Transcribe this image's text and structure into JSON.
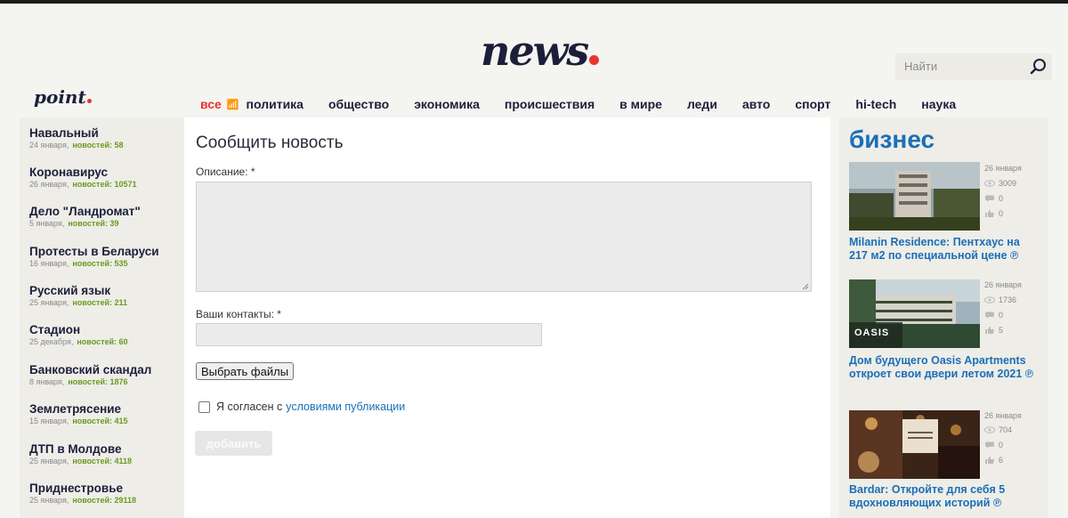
{
  "header": {
    "logo_main": "news",
    "logo_secondary": "point",
    "search_placeholder": "Найти",
    "accent_color": "#e8362b",
    "brand_color": "#1c1f3a"
  },
  "nav": {
    "active": "все",
    "items": [
      "политика",
      "общество",
      "экономика",
      "происшествия",
      "в мире",
      "леди",
      "авто",
      "спорт",
      "hi-tech",
      "наука"
    ]
  },
  "topics": [
    {
      "title": "Навальный",
      "date": "24 января,",
      "count_label": "новостей:",
      "count": "58"
    },
    {
      "title": "Коронавирус",
      "date": "26 января,",
      "count_label": "новостей:",
      "count": "10571"
    },
    {
      "title": "Дело \"Ландромат\"",
      "date": "5 января,",
      "count_label": "новостей:",
      "count": "39"
    },
    {
      "title": "Протесты в Беларуси",
      "date": "16 января,",
      "count_label": "новостей:",
      "count": "535"
    },
    {
      "title": "Русский язык",
      "date": "25 января,",
      "count_label": "новостей:",
      "count": "211"
    },
    {
      "title": "Стадион",
      "date": "25 декабря,",
      "count_label": "новостей:",
      "count": "60"
    },
    {
      "title": "Банковский скандал",
      "date": "8 января,",
      "count_label": "новостей:",
      "count": "1876"
    },
    {
      "title": "Землетрясение",
      "date": "15 января,",
      "count_label": "новостей:",
      "count": "415"
    },
    {
      "title": "ДТП в Молдове",
      "date": "25 января,",
      "count_label": "новостей:",
      "count": "4118"
    },
    {
      "title": "Приднестровье",
      "date": "25 января,",
      "count_label": "новостей:",
      "count": "29118"
    }
  ],
  "modal": {
    "title": "Сообщить новость",
    "description_label": "Описание: *",
    "contacts_label": "Ваши контакты: *",
    "file_button": "Выбрать файлы",
    "agree_text": "Я согласен с",
    "agree_link": "условиями публикации",
    "submit_label": "добавить"
  },
  "right": {
    "title": "бизнес",
    "cards": [
      {
        "date": "26 января",
        "views": "3009",
        "comments": "0",
        "likes": "0",
        "title": "Milanin Residence: Пентхаус на 217 м2 по специальной цене ℗",
        "image": "apartment-building-photo"
      },
      {
        "date": "26 января",
        "views": "1736",
        "comments": "0",
        "likes": "5",
        "title": "Дом будущего Oasis Apartments откроет свои двери летом 2021 ℗",
        "image": "oasis-building-photo",
        "image_caption": "OASIS"
      },
      {
        "date": "26 января",
        "views": "704",
        "comments": "0",
        "likes": "6",
        "title": "Bardar: Откройте для себя 5 вдохновляющих историй ℗",
        "image": "interior-photo"
      }
    ]
  }
}
